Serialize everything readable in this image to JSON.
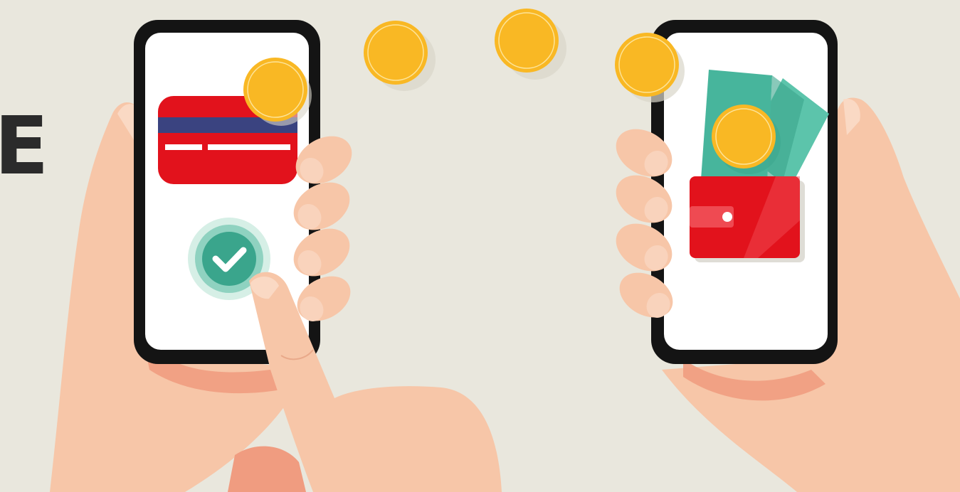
{
  "scene": {
    "edge_text": "E",
    "colors": {
      "background": "#e9e7dd",
      "skin": "#f7c6a8",
      "skin_shadow": "#f09c80",
      "phone_frame": "#141414",
      "screen": "#ffffff",
      "coin": "#f9b824",
      "card_red": "#e2121c",
      "card_stripe": "#3a4380",
      "check_green": "#3aa58c",
      "cash_green": "#47b59c",
      "wallet_red": "#e2121c"
    },
    "left_phone": {
      "content": [
        "credit-card",
        "coin",
        "confirm-check-button"
      ]
    },
    "right_phone": {
      "content": [
        "banknotes",
        "coin",
        "wallet"
      ]
    },
    "flying_coins": 3
  }
}
